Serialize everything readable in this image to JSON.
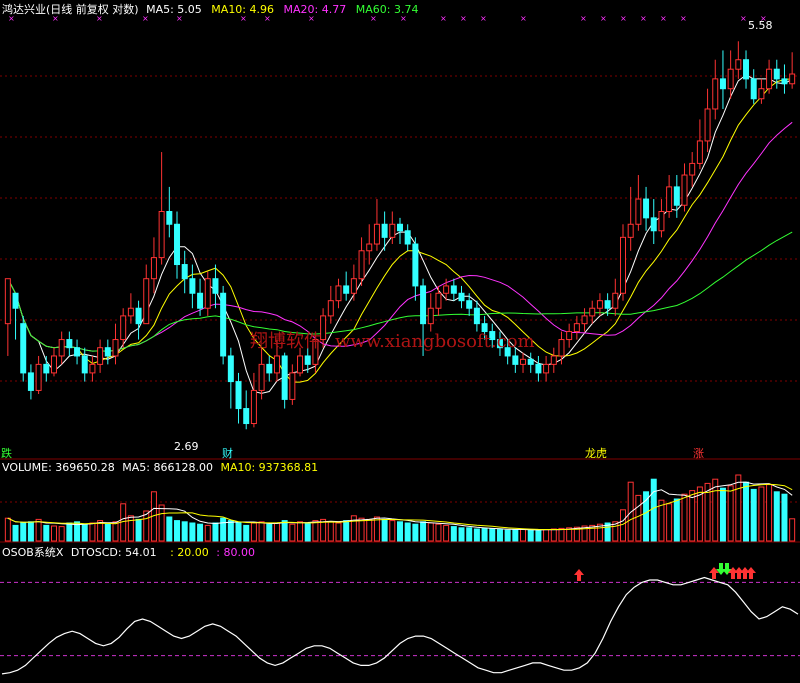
{
  "colors": {
    "background": "#000000",
    "title": "#ffffff",
    "ma5": "#ffffff",
    "ma10": "#ffff00",
    "ma20": "#ff33ff",
    "ma60": "#33ff33",
    "up": "#ff3333",
    "down": "#33ffff",
    "grid": "#800000",
    "mid_dash": "#cc33cc",
    "watermark": "#b01414"
  },
  "header": {
    "title": "鸿达兴业(日线 前复权 对数)",
    "ma5_label": "MA5: 5.05",
    "ma10_label": "MA10: 4.96",
    "ma20_label": "MA20: 4.77",
    "ma60_label": "MA60: 3.74"
  },
  "watermark": {
    "cn": "翔博软件",
    "url": "www.xiangbosoft.com"
  },
  "annotations": {
    "price_high": "5.58",
    "price_low": "2.69",
    "markers": [
      "跌",
      "财",
      "龙虎",
      "涨"
    ]
  },
  "volume_header": {
    "title": "VOLUME: 369650.28",
    "ma5_label": "MA5: 866128.00",
    "ma10_label": "MA10: 937368.81"
  },
  "osc_header": {
    "title": "OSOB系统X",
    "value_label": "DTOSCD: 54.01",
    "level1": ": 20.00",
    "level2": ": 80.00"
  },
  "chart_data": [
    {
      "type": "candlestick",
      "title": "鸿达兴业(日线 前复权 对数)",
      "price_high_marker": 5.58,
      "price_low_marker": 2.69,
      "y_log": true,
      "series_names": [
        "MA5",
        "MA10",
        "MA20",
        "MA60"
      ],
      "latest_values": {
        "MA5": 5.05,
        "MA10": 4.96,
        "MA20": 4.77,
        "MA60": 3.74
      },
      "candles": [
        [
          3.3,
          3.6,
          3.1,
          3.5
        ],
        [
          3.5,
          3.4,
          3.2,
          3.5
        ],
        [
          3.3,
          3.0,
          2.95,
          3.35
        ],
        [
          3.0,
          2.9,
          2.85,
          3.05
        ],
        [
          2.9,
          3.05,
          2.88,
          3.1
        ],
        [
          3.05,
          3.0,
          2.95,
          3.1
        ],
        [
          3.0,
          3.1,
          2.98,
          3.15
        ],
        [
          3.1,
          3.2,
          3.05,
          3.25
        ],
        [
          3.2,
          3.15,
          3.1,
          3.25
        ],
        [
          3.15,
          3.1,
          3.05,
          3.2
        ],
        [
          3.1,
          3.0,
          2.95,
          3.15
        ],
        [
          3.0,
          3.05,
          2.95,
          3.1
        ],
        [
          3.05,
          3.15,
          3.0,
          3.2
        ],
        [
          3.15,
          3.1,
          3.05,
          3.2
        ],
        [
          3.1,
          3.2,
          3.05,
          3.3
        ],
        [
          3.2,
          3.35,
          3.15,
          3.4
        ],
        [
          3.35,
          3.4,
          3.3,
          3.5
        ],
        [
          3.4,
          3.3,
          3.2,
          3.45
        ],
        [
          3.3,
          3.6,
          3.3,
          3.7
        ],
        [
          3.6,
          3.75,
          3.5,
          3.9
        ],
        [
          3.75,
          4.1,
          3.7,
          4.6
        ],
        [
          4.1,
          4.0,
          3.9,
          4.3
        ],
        [
          4.0,
          3.7,
          3.6,
          4.1
        ],
        [
          3.7,
          3.6,
          3.5,
          3.8
        ],
        [
          3.6,
          3.5,
          3.4,
          3.7
        ],
        [
          3.5,
          3.4,
          3.35,
          3.6
        ],
        [
          3.4,
          3.6,
          3.35,
          3.65
        ],
        [
          3.6,
          3.5,
          3.4,
          3.7
        ],
        [
          3.5,
          3.1,
          3.05,
          3.55
        ],
        [
          3.1,
          2.95,
          2.8,
          3.15
        ],
        [
          2.95,
          2.8,
          2.72,
          3.0
        ],
        [
          2.8,
          2.72,
          2.69,
          2.9
        ],
        [
          2.72,
          2.9,
          2.7,
          3.0
        ],
        [
          2.9,
          3.05,
          2.85,
          3.15
        ],
        [
          3.05,
          3.0,
          2.95,
          3.1
        ],
        [
          3.0,
          3.1,
          2.95,
          3.2
        ],
        [
          3.1,
          2.85,
          2.8,
          3.12
        ],
        [
          2.85,
          3.0,
          2.82,
          3.05
        ],
        [
          3.0,
          3.1,
          2.98,
          3.15
        ],
        [
          3.1,
          3.05,
          3.0,
          3.15
        ],
        [
          3.05,
          3.2,
          3.0,
          3.25
        ],
        [
          3.2,
          3.35,
          3.15,
          3.4
        ],
        [
          3.35,
          3.45,
          3.3,
          3.55
        ],
        [
          3.45,
          3.55,
          3.4,
          3.6
        ],
        [
          3.55,
          3.5,
          3.45,
          3.65
        ],
        [
          3.5,
          3.6,
          3.45,
          3.7
        ],
        [
          3.6,
          3.8,
          3.55,
          3.9
        ],
        [
          3.8,
          3.85,
          3.7,
          4.0
        ],
        [
          3.85,
          4.0,
          3.8,
          4.2
        ],
        [
          4.0,
          3.9,
          3.8,
          4.1
        ],
        [
          3.9,
          4.0,
          3.85,
          4.1
        ],
        [
          4.0,
          3.95,
          3.85,
          4.05
        ],
        [
          3.95,
          3.85,
          3.8,
          4.0
        ],
        [
          3.85,
          3.55,
          3.45,
          3.9
        ],
        [
          3.55,
          3.3,
          3.1,
          3.6
        ],
        [
          3.3,
          3.4,
          3.25,
          3.5
        ],
        [
          3.4,
          3.5,
          3.35,
          3.55
        ],
        [
          3.5,
          3.55,
          3.45,
          3.6
        ],
        [
          3.55,
          3.5,
          3.45,
          3.6
        ],
        [
          3.5,
          3.45,
          3.4,
          3.55
        ],
        [
          3.45,
          3.4,
          3.35,
          3.5
        ],
        [
          3.4,
          3.3,
          3.25,
          3.45
        ],
        [
          3.3,
          3.25,
          3.2,
          3.35
        ],
        [
          3.25,
          3.2,
          3.15,
          3.3
        ],
        [
          3.2,
          3.15,
          3.1,
          3.25
        ],
        [
          3.15,
          3.1,
          3.05,
          3.2
        ],
        [
          3.1,
          3.05,
          3.0,
          3.15
        ],
        [
          3.05,
          3.08,
          3.0,
          3.12
        ],
        [
          3.08,
          3.05,
          3.0,
          3.12
        ],
        [
          3.05,
          3.0,
          2.95,
          3.1
        ],
        [
          3.0,
          3.05,
          2.95,
          3.1
        ],
        [
          3.05,
          3.1,
          3.0,
          3.15
        ],
        [
          3.1,
          3.2,
          3.05,
          3.25
        ],
        [
          3.2,
          3.25,
          3.15,
          3.3
        ],
        [
          3.25,
          3.3,
          3.2,
          3.35
        ],
        [
          3.3,
          3.35,
          3.25,
          3.4
        ],
        [
          3.35,
          3.4,
          3.3,
          3.45
        ],
        [
          3.4,
          3.45,
          3.35,
          3.5
        ],
        [
          3.45,
          3.4,
          3.35,
          3.5
        ],
        [
          3.4,
          3.5,
          3.35,
          3.6
        ],
        [
          3.5,
          3.9,
          3.45,
          4.0
        ],
        [
          3.9,
          4.0,
          3.8,
          4.3
        ],
        [
          4.0,
          4.2,
          3.95,
          4.4
        ],
        [
          4.2,
          4.05,
          3.95,
          4.3
        ],
        [
          4.05,
          3.95,
          3.85,
          4.2
        ],
        [
          3.95,
          4.1,
          3.9,
          4.2
        ],
        [
          4.1,
          4.3,
          4.05,
          4.4
        ],
        [
          4.3,
          4.15,
          4.05,
          4.4
        ],
        [
          4.15,
          4.4,
          4.1,
          4.5
        ],
        [
          4.4,
          4.5,
          4.3,
          4.6
        ],
        [
          4.5,
          4.7,
          4.45,
          4.9
        ],
        [
          4.7,
          5.0,
          4.6,
          5.2
        ],
        [
          5.0,
          5.3,
          4.9,
          5.5
        ],
        [
          5.3,
          5.2,
          5.0,
          5.6
        ],
        [
          5.2,
          5.4,
          5.1,
          5.6
        ],
        [
          5.4,
          5.5,
          5.3,
          5.7
        ],
        [
          5.5,
          5.3,
          5.2,
          5.6
        ],
        [
          5.3,
          5.1,
          5.05,
          5.4
        ],
        [
          5.1,
          5.2,
          5.05,
          5.3
        ],
        [
          5.2,
          5.4,
          5.15,
          5.5
        ],
        [
          5.4,
          5.3,
          5.2,
          5.5
        ],
        [
          5.3,
          5.25,
          5.15,
          5.45
        ],
        [
          5.25,
          5.35,
          5.2,
          5.58
        ]
      ],
      "markers": [
        "跌",
        "财",
        "龙虎",
        "涨"
      ]
    },
    {
      "type": "bar",
      "title": "VOLUME",
      "latest": 369650.28,
      "ma5": 866128.0,
      "ma10": 937368.81,
      "values": [
        380000,
        260000,
        300000,
        320000,
        360000,
        260000,
        250000,
        240000,
        300000,
        320000,
        280000,
        300000,
        340000,
        280000,
        320000,
        620000,
        420000,
        360000,
        500000,
        820000,
        600000,
        400000,
        340000,
        320000,
        300000,
        280000,
        260000,
        300000,
        380000,
        340000,
        300000,
        260000,
        300000,
        320000,
        280000,
        300000,
        340000,
        280000,
        320000,
        300000,
        340000,
        360000,
        320000,
        300000,
        340000,
        420000,
        380000,
        360000,
        400000,
        360000,
        340000,
        320000,
        300000,
        280000,
        320000,
        300000,
        280000,
        260000,
        240000,
        220000,
        220000,
        200000,
        210000,
        200000,
        190000,
        180000,
        190000,
        200000,
        180000,
        170000,
        190000,
        200000,
        210000,
        220000,
        230000,
        250000,
        260000,
        280000,
        300000,
        320000,
        520000,
        980000,
        760000,
        820000,
        1030000,
        680000,
        620000,
        700000,
        780000,
        840000,
        900000,
        960000,
        1030000,
        880000,
        920000,
        1100000,
        980000,
        860000,
        900000,
        940000,
        820000,
        780000,
        370000
      ]
    },
    {
      "type": "line",
      "title": "OSOB系统X",
      "series_name": "DTOSCD",
      "latest": 54.01,
      "levels": [
        20.0,
        80.0
      ],
      "ylim": [
        0,
        100
      ],
      "values": [
        5,
        6,
        8,
        12,
        18,
        24,
        30,
        35,
        38,
        40,
        38,
        34,
        30,
        28,
        30,
        35,
        42,
        48,
        50,
        48,
        44,
        40,
        36,
        34,
        36,
        40,
        44,
        46,
        44,
        40,
        36,
        30,
        24,
        18,
        14,
        12,
        14,
        18,
        22,
        26,
        28,
        28,
        26,
        22,
        18,
        14,
        12,
        12,
        14,
        18,
        24,
        30,
        34,
        36,
        36,
        34,
        30,
        26,
        22,
        18,
        14,
        10,
        8,
        6,
        6,
        8,
        10,
        12,
        14,
        14,
        12,
        10,
        8,
        8,
        10,
        14,
        22,
        34,
        48,
        60,
        70,
        76,
        80,
        82,
        82,
        80,
        78,
        78,
        80,
        82,
        84,
        82,
        80,
        78,
        72,
        64,
        56,
        50,
        52,
        56,
        60,
        58,
        54
      ],
      "arrows_up_count": 7,
      "arrows_down_count": 2
    }
  ]
}
